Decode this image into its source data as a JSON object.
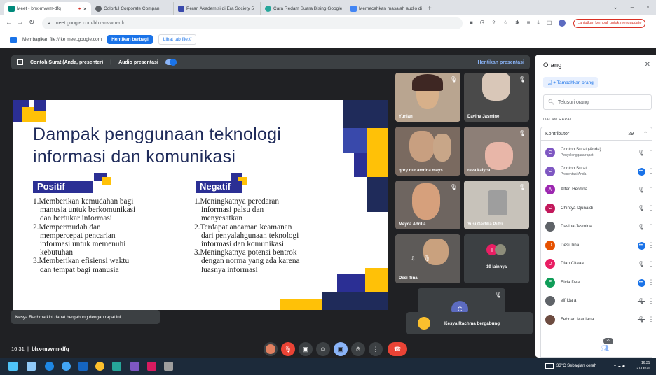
{
  "tabs": [
    {
      "label": "Meet - bhx-mvwm-dfq",
      "active": true
    },
    {
      "label": "Colorful Corporate Compan",
      "active": false
    },
    {
      "label": "Peran Akademisi di Era Society 5",
      "active": false
    },
    {
      "label": "Cara Redam Suara Bising Google",
      "active": false
    },
    {
      "label": "Memecahkan masalah audio di",
      "active": false
    }
  ],
  "new_tab": "+",
  "address": "meet.google.com/bhx-mvwm-dfq",
  "update_label": "Lanjutkan kembali untuk mengupdate",
  "sharebar": {
    "text": "Membagikan file:// ke meet.google.com",
    "stop": "Hentikan berbagi",
    "view": "Lihat tab file://"
  },
  "presenting": {
    "label": "Contoh Surat (Anda, presenter)",
    "audio": "Audio presentasi",
    "stop": "Hentikan presentasi"
  },
  "slide": {
    "title_line1": "Dampak penggunaan teknologi",
    "title_line2": "informasi dan komunikasi",
    "pos_header": "Positif",
    "neg_header": "Negatif",
    "positif": [
      "1.Memberikan kemudahan bagi",
      "manusia untuk berkomunikasi",
      "dan bertukar informasi",
      "2.Mempermudah dan",
      "mempercepat pencarian",
      "informasi untuk memenuhi",
      "kebutuhan",
      "3.Memberikan efisiensi waktu",
      "dan tempat bagi manusia"
    ],
    "negatif": [
      "1.Meningkatnya peredaran",
      "informasi palsu dan",
      "menyesatkan",
      "2.Terdapat ancaman keamanan",
      "dari penyalahgunaan teknologi",
      "informasi dan komunikasi",
      "3.Meningkatnya potensi bentrok",
      "dengan norma yang ada karena",
      "luasnya informasi"
    ]
  },
  "tiles": [
    {
      "name": "Yunian"
    },
    {
      "name": "Davina Jasmine"
    },
    {
      "name": "qory nur amrina mays..."
    },
    {
      "name": "reva kalyca"
    },
    {
      "name": "Meyca Adrilla"
    },
    {
      "name": "Yusi Gertika Putri"
    },
    {
      "name": "Desi Tina"
    },
    {
      "name": "19 lainnya",
      "avatar": "I"
    }
  ],
  "toasts": {
    "left": "Kesya Rachma kini dapat bergabung dengan rapat ini",
    "right": "Kesya Rachma bergabung"
  },
  "panel": {
    "title": "Orang",
    "add": "Tambahkan orang",
    "search_placeholder": "Telusuri orang",
    "section": "DALAM RAPAT",
    "contributors": "Kontributor",
    "count": "29",
    "people": [
      {
        "name": "Contoh Surat (Anda)",
        "sub": "Penyelenggara rapat",
        "color": "#7e57c2",
        "letter": "C",
        "icon": "mic-off-icon"
      },
      {
        "name": "Contoh Surat",
        "sub": "Presentasi Anda",
        "color": "#7e57c2",
        "letter": "C",
        "icon": "speaking-icon"
      },
      {
        "name": "Alfen Herdina",
        "sub": "",
        "color": "#9c27b0",
        "letter": "A",
        "icon": "mic-off-icon"
      },
      {
        "name": "Chintya Djunaidi",
        "sub": "",
        "color": "#c2185b",
        "letter": "C",
        "icon": "mic-off-icon"
      },
      {
        "name": "Davina Jasmine",
        "sub": "",
        "color": "#5f6368",
        "letter": "",
        "icon": "mic-off-icon"
      },
      {
        "name": "Desi Tina",
        "sub": "",
        "color": "#e65100",
        "letter": "D",
        "icon": "speaking-icon"
      },
      {
        "name": "Dian Citaaa",
        "sub": "",
        "color": "#e91e63",
        "letter": "D",
        "icon": "mic-off-icon"
      },
      {
        "name": "Elcia Dea",
        "sub": "",
        "color": "#0f9d58",
        "letter": "E",
        "icon": "speaking-icon"
      },
      {
        "name": "elfrida a",
        "sub": "",
        "color": "#5f6368",
        "letter": "",
        "icon": "mic-off-icon"
      },
      {
        "name": "Febrian Maulana",
        "sub": "",
        "color": "#6d4c41",
        "letter": "",
        "icon": "mic-off-icon"
      }
    ]
  },
  "bottom": {
    "time": "16.31",
    "code": "bhx-mvwm-dfq",
    "badge": "29"
  },
  "taskbar": {
    "weather": "33°C Sebagian cerah",
    "clock": "16:31",
    "date": "21/06/20"
  }
}
